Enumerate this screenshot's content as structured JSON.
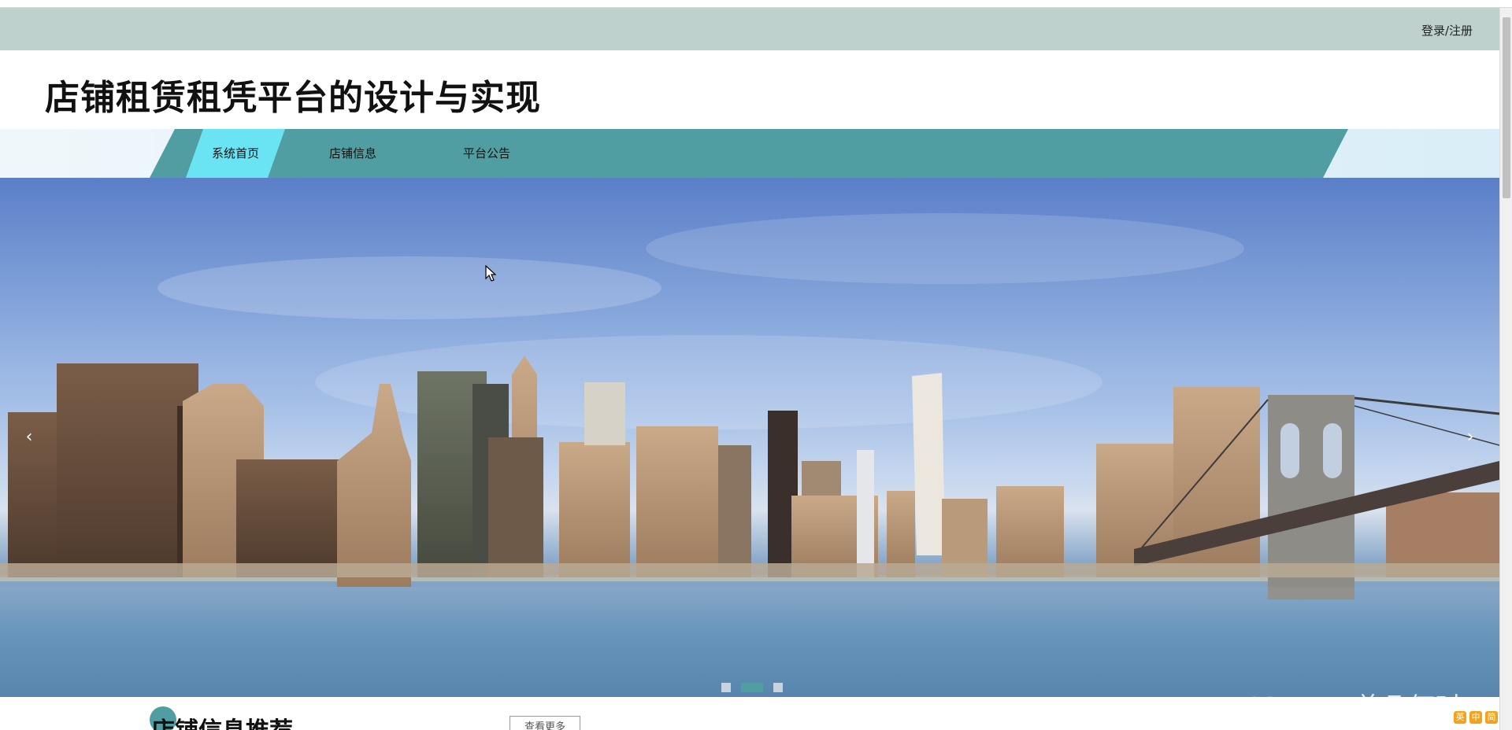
{
  "header": {
    "login_label": "登录/注册",
    "site_title": "店铺租赁租凭平台的设计与实现"
  },
  "nav": {
    "items": [
      {
        "label": "系统首页",
        "active": true
      },
      {
        "label": "店铺信息",
        "active": false
      },
      {
        "label": "平台公告",
        "active": false
      }
    ]
  },
  "banner": {
    "prev_arrow": "‹",
    "next_arrow": "›",
    "slides": 3,
    "active_slide": 2
  },
  "section": {
    "title": "店铺信息推荐",
    "more_label": "查看更多"
  },
  "watermark": {
    "text": "CSDN @曾几何时…"
  },
  "tray": {
    "items": [
      "英",
      "中",
      "简"
    ]
  },
  "colors": {
    "util_bar": "#bfd1cd",
    "nav_band": "#509da2",
    "nav_active": "#6ae4f2",
    "accent": "#509da2"
  }
}
